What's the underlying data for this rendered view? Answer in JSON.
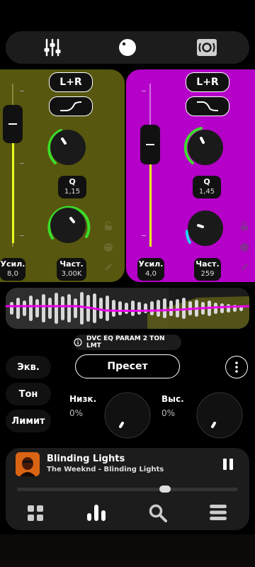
{
  "topbar": {
    "items": [
      {
        "name": "equalizer",
        "icon": "sliders-icon"
      },
      {
        "name": "volume",
        "icon": "knob-icon"
      },
      {
        "name": "speaker",
        "icon": "speaker-icon"
      }
    ]
  },
  "left_band": {
    "color": "#5a5a10",
    "channel": "L+R",
    "q_label": "Q",
    "q_value": "1,15",
    "gain_label": "Усил.",
    "gain_value": "8,0",
    "freq_label": "Част.",
    "freq_value": "3,00K"
  },
  "right_band": {
    "color": "#b300c8",
    "channel": "L+R",
    "q_label": "Q",
    "q_value": "1,45",
    "gain_label": "Усил.",
    "gain_value": "4,0",
    "freq_label": "Част.",
    "freq_value": "259"
  },
  "preset_info": "DVC EQ PARAM 2 TON LMT",
  "side_buttons": {
    "eq": "Экв.",
    "tone": "Тон",
    "limit": "Лимит"
  },
  "preset_button": "Пресет",
  "tone": {
    "low_label": "Низк.",
    "low_value": "0%",
    "high_label": "Выс.",
    "high_value": "0%"
  },
  "player": {
    "title": "Blinding Lights",
    "subtitle": "The Weeknd - Blinding Lights",
    "progress": 0.68
  },
  "bottom_nav": [
    {
      "icon": "grid-icon"
    },
    {
      "icon": "equalizer-bars-icon"
    },
    {
      "icon": "search-icon"
    },
    {
      "icon": "menu-icon"
    }
  ],
  "colors": {
    "green": "#3ddc2a",
    "cyan": "#22d4f0",
    "yellow_line": "#e8ff1a",
    "magenta": "#e800e8"
  }
}
